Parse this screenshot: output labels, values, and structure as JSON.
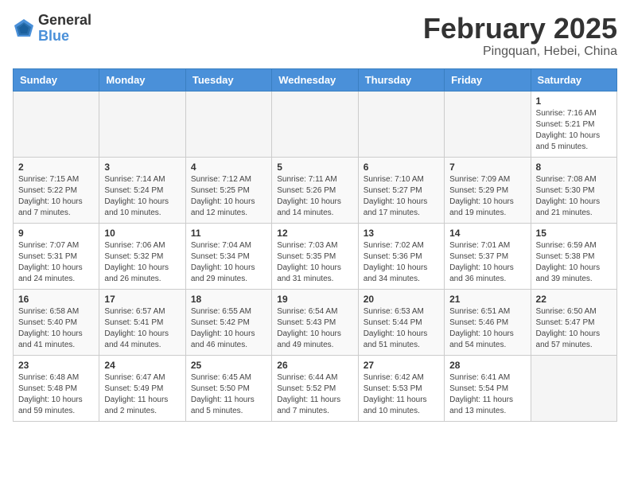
{
  "logo": {
    "general": "General",
    "blue": "Blue"
  },
  "header": {
    "title": "February 2025",
    "subtitle": "Pingquan, Hebei, China"
  },
  "weekdays": [
    "Sunday",
    "Monday",
    "Tuesday",
    "Wednesday",
    "Thursday",
    "Friday",
    "Saturday"
  ],
  "weeks": [
    [
      {
        "day": "",
        "info": ""
      },
      {
        "day": "",
        "info": ""
      },
      {
        "day": "",
        "info": ""
      },
      {
        "day": "",
        "info": ""
      },
      {
        "day": "",
        "info": ""
      },
      {
        "day": "",
        "info": ""
      },
      {
        "day": "1",
        "info": "Sunrise: 7:16 AM\nSunset: 5:21 PM\nDaylight: 10 hours\nand 5 minutes."
      }
    ],
    [
      {
        "day": "2",
        "info": "Sunrise: 7:15 AM\nSunset: 5:22 PM\nDaylight: 10 hours\nand 7 minutes."
      },
      {
        "day": "3",
        "info": "Sunrise: 7:14 AM\nSunset: 5:24 PM\nDaylight: 10 hours\nand 10 minutes."
      },
      {
        "day": "4",
        "info": "Sunrise: 7:12 AM\nSunset: 5:25 PM\nDaylight: 10 hours\nand 12 minutes."
      },
      {
        "day": "5",
        "info": "Sunrise: 7:11 AM\nSunset: 5:26 PM\nDaylight: 10 hours\nand 14 minutes."
      },
      {
        "day": "6",
        "info": "Sunrise: 7:10 AM\nSunset: 5:27 PM\nDaylight: 10 hours\nand 17 minutes."
      },
      {
        "day": "7",
        "info": "Sunrise: 7:09 AM\nSunset: 5:29 PM\nDaylight: 10 hours\nand 19 minutes."
      },
      {
        "day": "8",
        "info": "Sunrise: 7:08 AM\nSunset: 5:30 PM\nDaylight: 10 hours\nand 21 minutes."
      }
    ],
    [
      {
        "day": "9",
        "info": "Sunrise: 7:07 AM\nSunset: 5:31 PM\nDaylight: 10 hours\nand 24 minutes."
      },
      {
        "day": "10",
        "info": "Sunrise: 7:06 AM\nSunset: 5:32 PM\nDaylight: 10 hours\nand 26 minutes."
      },
      {
        "day": "11",
        "info": "Sunrise: 7:04 AM\nSunset: 5:34 PM\nDaylight: 10 hours\nand 29 minutes."
      },
      {
        "day": "12",
        "info": "Sunrise: 7:03 AM\nSunset: 5:35 PM\nDaylight: 10 hours\nand 31 minutes."
      },
      {
        "day": "13",
        "info": "Sunrise: 7:02 AM\nSunset: 5:36 PM\nDaylight: 10 hours\nand 34 minutes."
      },
      {
        "day": "14",
        "info": "Sunrise: 7:01 AM\nSunset: 5:37 PM\nDaylight: 10 hours\nand 36 minutes."
      },
      {
        "day": "15",
        "info": "Sunrise: 6:59 AM\nSunset: 5:38 PM\nDaylight: 10 hours\nand 39 minutes."
      }
    ],
    [
      {
        "day": "16",
        "info": "Sunrise: 6:58 AM\nSunset: 5:40 PM\nDaylight: 10 hours\nand 41 minutes."
      },
      {
        "day": "17",
        "info": "Sunrise: 6:57 AM\nSunset: 5:41 PM\nDaylight: 10 hours\nand 44 minutes."
      },
      {
        "day": "18",
        "info": "Sunrise: 6:55 AM\nSunset: 5:42 PM\nDaylight: 10 hours\nand 46 minutes."
      },
      {
        "day": "19",
        "info": "Sunrise: 6:54 AM\nSunset: 5:43 PM\nDaylight: 10 hours\nand 49 minutes."
      },
      {
        "day": "20",
        "info": "Sunrise: 6:53 AM\nSunset: 5:44 PM\nDaylight: 10 hours\nand 51 minutes."
      },
      {
        "day": "21",
        "info": "Sunrise: 6:51 AM\nSunset: 5:46 PM\nDaylight: 10 hours\nand 54 minutes."
      },
      {
        "day": "22",
        "info": "Sunrise: 6:50 AM\nSunset: 5:47 PM\nDaylight: 10 hours\nand 57 minutes."
      }
    ],
    [
      {
        "day": "23",
        "info": "Sunrise: 6:48 AM\nSunset: 5:48 PM\nDaylight: 10 hours\nand 59 minutes."
      },
      {
        "day": "24",
        "info": "Sunrise: 6:47 AM\nSunset: 5:49 PM\nDaylight: 11 hours\nand 2 minutes."
      },
      {
        "day": "25",
        "info": "Sunrise: 6:45 AM\nSunset: 5:50 PM\nDaylight: 11 hours\nand 5 minutes."
      },
      {
        "day": "26",
        "info": "Sunrise: 6:44 AM\nSunset: 5:52 PM\nDaylight: 11 hours\nand 7 minutes."
      },
      {
        "day": "27",
        "info": "Sunrise: 6:42 AM\nSunset: 5:53 PM\nDaylight: 11 hours\nand 10 minutes."
      },
      {
        "day": "28",
        "info": "Sunrise: 6:41 AM\nSunset: 5:54 PM\nDaylight: 11 hours\nand 13 minutes."
      },
      {
        "day": "",
        "info": ""
      }
    ]
  ]
}
